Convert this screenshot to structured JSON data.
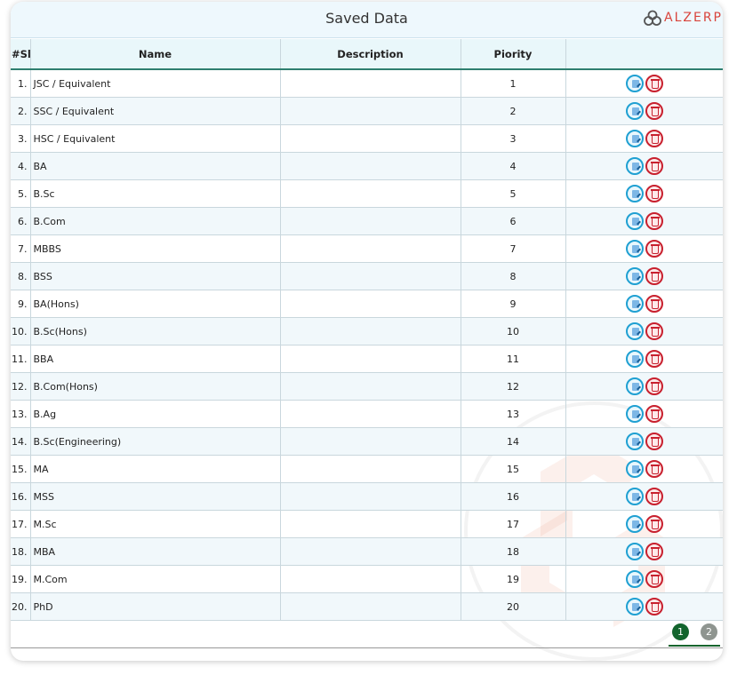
{
  "header": {
    "title": "Saved Data",
    "logo_text": "ALZERP"
  },
  "columns": {
    "sl": "#Sl",
    "name": "Name",
    "description": "Description",
    "priority": "Piority",
    "actions": ""
  },
  "rows": [
    {
      "sl": "1.",
      "name": "JSC / Equivalent",
      "description": "",
      "priority": "1"
    },
    {
      "sl": "2.",
      "name": "SSC / Equivalent",
      "description": "",
      "priority": "2"
    },
    {
      "sl": "3.",
      "name": "HSC / Equivalent",
      "description": "",
      "priority": "3"
    },
    {
      "sl": "4.",
      "name": "BA",
      "description": "",
      "priority": "4"
    },
    {
      "sl": "5.",
      "name": "B.Sc",
      "description": "",
      "priority": "5"
    },
    {
      "sl": "6.",
      "name": "B.Com",
      "description": "",
      "priority": "6"
    },
    {
      "sl": "7.",
      "name": "MBBS",
      "description": "",
      "priority": "7"
    },
    {
      "sl": "8.",
      "name": "BSS",
      "description": "",
      "priority": "8"
    },
    {
      "sl": "9.",
      "name": "BA(Hons)",
      "description": "",
      "priority": "9"
    },
    {
      "sl": "10.",
      "name": "B.Sc(Hons)",
      "description": "",
      "priority": "10"
    },
    {
      "sl": "11.",
      "name": "BBA",
      "description": "",
      "priority": "11"
    },
    {
      "sl": "12.",
      "name": "B.Com(Hons)",
      "description": "",
      "priority": "12"
    },
    {
      "sl": "13.",
      "name": "B.Ag",
      "description": "",
      "priority": "13"
    },
    {
      "sl": "14.",
      "name": "B.Sc(Engineering)",
      "description": "",
      "priority": "14"
    },
    {
      "sl": "15.",
      "name": "MA",
      "description": "",
      "priority": "15"
    },
    {
      "sl": "16.",
      "name": "MSS",
      "description": "",
      "priority": "16"
    },
    {
      "sl": "17.",
      "name": "M.Sc",
      "description": "",
      "priority": "17"
    },
    {
      "sl": "18.",
      "name": "MBA",
      "description": "",
      "priority": "18"
    },
    {
      "sl": "19.",
      "name": "M.Com",
      "description": "",
      "priority": "19"
    },
    {
      "sl": "20.",
      "name": "PhD",
      "description": "",
      "priority": "20"
    }
  ],
  "row_icons": {
    "edit": "edit-icon",
    "delete": "delete-icon"
  },
  "pagination": {
    "pages": [
      "1",
      "2"
    ],
    "current": "1"
  },
  "colors": {
    "accent": "#13642d",
    "edit": "#1fa0d2",
    "delete": "#c8202e",
    "logo": "#d9443c"
  }
}
